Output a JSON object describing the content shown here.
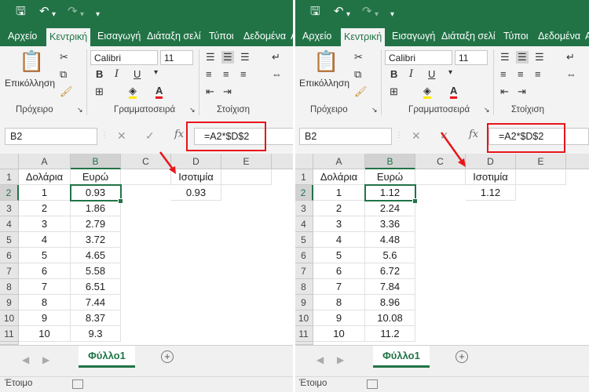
{
  "left": {
    "qat": {
      "save_icon": "save-icon",
      "undo_icon": "undo-icon",
      "redo_icon": "redo-icon",
      "more_icon": "customize-icon"
    },
    "tabs": [
      "Αρχείο",
      "Κεντρική",
      "Εισαγωγή",
      "Διάταξη σελί",
      "Τύποι",
      "Δεδομένα",
      "Α"
    ],
    "ribbon": {
      "paste_label": "Επικόλληση",
      "font_name": "Calibri",
      "font_size": "11",
      "bold": "B",
      "italic": "I",
      "underline": "U",
      "groups": [
        "Πρόχειρο",
        "Γραμματοσειρά",
        "Στοίχιση"
      ]
    },
    "name_box": "B2",
    "fx": "fx",
    "formula": "=A2*$D$2",
    "columns": [
      "A",
      "B",
      "C",
      "D",
      "E"
    ],
    "rows": [
      "1",
      "2",
      "3",
      "4",
      "5",
      "6",
      "7",
      "8",
      "9",
      "10",
      "11",
      "12"
    ],
    "cells": {
      "A1": "Δολάρια",
      "B1": "Ευρώ",
      "D1": "Ισοτιμία",
      "D2": "0.93",
      "A": [
        "1",
        "2",
        "3",
        "4",
        "5",
        "6",
        "7",
        "8",
        "9",
        "10"
      ],
      "B": [
        "0.93",
        "1.86",
        "2.79",
        "3.72",
        "4.65",
        "5.58",
        "6.51",
        "7.44",
        "8.37",
        "9.3"
      ]
    },
    "sheet_tab": "Φύλλο1",
    "status": "Έτοιμο"
  },
  "right": {
    "qat": {
      "save_icon": "save-icon",
      "undo_icon": "undo-icon",
      "redo_icon": "redo-icon",
      "more_icon": "customize-icon"
    },
    "tabs": [
      "Αρχείο",
      "Κεντρική",
      "Εισαγωγή",
      "Διάταξη σελί",
      "Τύποι",
      "Δεδομένα",
      "Α"
    ],
    "ribbon": {
      "paste_label": "Επικόλληση",
      "font_name": "Calibri",
      "font_size": "11",
      "bold": "B",
      "italic": "I",
      "underline": "U",
      "groups": [
        "Πρόχειρο",
        "Γραμματοσειρά",
        "Στοίχιση"
      ]
    },
    "name_box": "B2",
    "fx": "fx",
    "formula": "=A2*$D$2",
    "columns": [
      "A",
      "B",
      "C",
      "D",
      "E"
    ],
    "rows": [
      "1",
      "2",
      "3",
      "4",
      "5",
      "6",
      "7",
      "8",
      "9",
      "10",
      "11",
      "12"
    ],
    "cells": {
      "A1": "Δολάρια",
      "B1": "Ευρώ",
      "D1": "Ισοτιμία",
      "D2": "1.12",
      "A": [
        "1",
        "2",
        "3",
        "4",
        "5",
        "6",
        "7",
        "8",
        "9",
        "10"
      ],
      "B": [
        "1.12",
        "2.24",
        "3.36",
        "4.48",
        "5.6",
        "6.72",
        "7.84",
        "8.96",
        "10.08",
        "11.2"
      ]
    },
    "sheet_tab": "Φύλλο1",
    "status": "Έτοιμο"
  },
  "colors": {
    "excel_green": "#217346",
    "annotation_red": "#e8151b"
  }
}
